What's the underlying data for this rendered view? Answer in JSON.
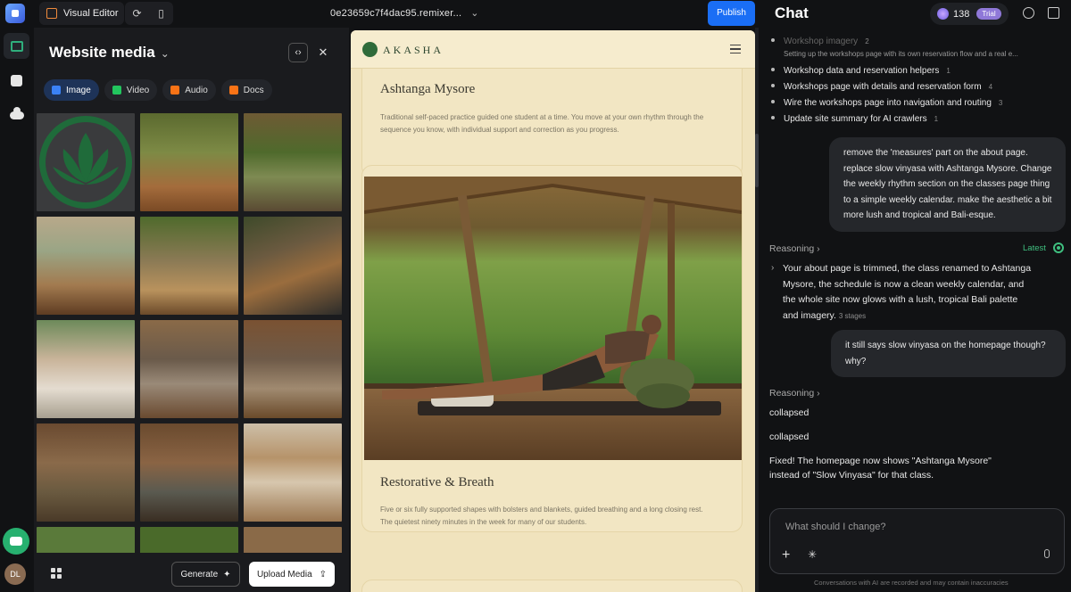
{
  "topbar": {
    "visual_editor_label": "Visual Editor",
    "project_name": "0e23659c7f4dac95.remixer...",
    "publish_label": "Publish"
  },
  "rail": {
    "avatar_initials": "DL"
  },
  "media": {
    "title": "Website media",
    "tabs": [
      {
        "label": "Image",
        "icon": "image-icon",
        "color": "#3b82f6"
      },
      {
        "label": "Video",
        "icon": "video-icon",
        "color": "#22c55e"
      },
      {
        "label": "Audio",
        "icon": "audio-icon",
        "color": "#f97316"
      },
      {
        "label": "Docs",
        "icon": "docs-icon",
        "color": "#f97316"
      }
    ],
    "generate_label": "Generate",
    "upload_label": "Upload Media"
  },
  "site": {
    "brand": "AKASHA",
    "card1": {
      "title": "Ashtanga Mysore",
      "text_line1": "Traditional self-paced practice guided one student at a time. You move at your own rhythm through the",
      "text_line2": "sequence you know, with individual support and correction as you progress."
    },
    "card2": {
      "title": "Restorative & Breath",
      "text_line1": "Five or six fully supported shapes with bolsters and blankets, guided breathing and a long closing rest.",
      "text_line2": "The quietest ninety minutes in the week for many of our students."
    }
  },
  "chat": {
    "title": "Chat",
    "credits": "138",
    "trial_badge": "Trial",
    "tasks": [
      {
        "label": "Workshop imagery",
        "count": "2"
      },
      {
        "label": "Workshop data and reservation helpers",
        "count": "1"
      },
      {
        "label": "Workshops page with details and reservation form",
        "count": "4"
      },
      {
        "label": "Wire the workshops page into navigation and routing",
        "count": "3"
      },
      {
        "label": "Update site summary for AI crawlers",
        "count": "1"
      }
    ],
    "task_sub": "Setting up the workshops page with its own reservation flow and a real e...",
    "user_msg1_l1": "remove the 'measures' part on the about page.",
    "user_msg1_l2": "replace slow vinyasa with Ashtanga Mysore. Change",
    "user_msg1_l3": "the weekly rhythm section on the classes page thing",
    "user_msg1_l4": "to a simple weekly calendar. make the aesthetic a bit",
    "user_msg1_l5": "more lush and tropical and Bali-esque.",
    "reasoning_label": "Reasoning",
    "latest_label": "Latest",
    "reason_l1": "Your about page is trimmed, the class renamed to Ashtanga",
    "reason_l2": "Mysore, the schedule is now a clean weekly calendar, and",
    "reason_l3": "the whole site now glows with a lush, tropical Bali palette",
    "reason_l4": "and imagery.",
    "reason_stages": "3 stages",
    "user_msg2_l1": "it still says slow vinyasa on the homepage though?",
    "user_msg2_l2": "why?",
    "collapsed_1": "collapsed",
    "collapsed_2": "collapsed",
    "fixed_l1": "Fixed! The homepage now shows \"Ashtanga Mysore\"",
    "fixed_l2": "instead of \"Slow Vinyasa\" for that class.",
    "input_placeholder": "What should I change?",
    "disclaimer": "Conversations with AI are recorded and may contain inaccuracies"
  }
}
